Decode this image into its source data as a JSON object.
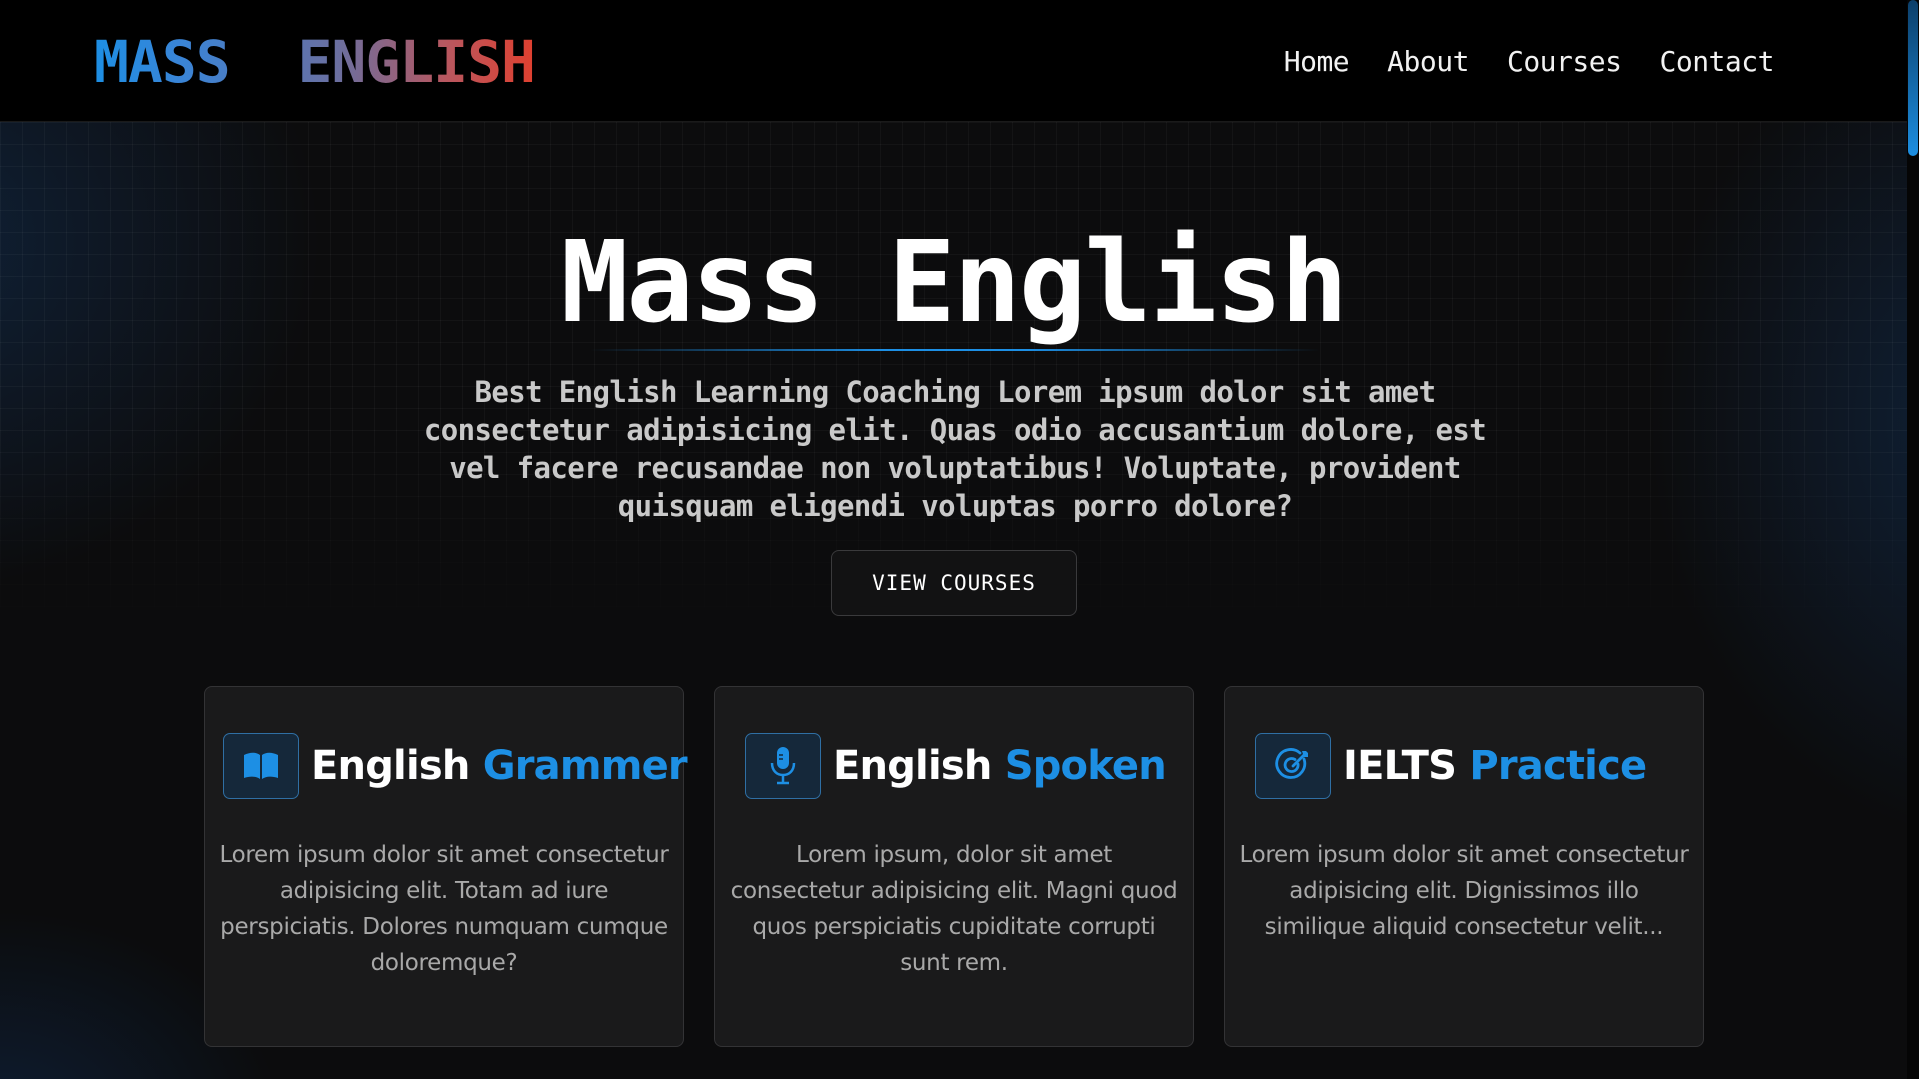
{
  "header": {
    "logo": "MASS  ENGLISH",
    "nav": [
      "Home",
      "About",
      "Courses",
      "Contact"
    ]
  },
  "hero": {
    "title": "Mass English",
    "subtitle": "Best English Learning Coaching Lorem ipsum dolor sit amet consectetur adipisicing elit. Quas odio accusantium dolore, est vel facere recusandae non voluptatibus! Voluptate, provident quisquam eligendi voluptas porro dolore?",
    "cta_label": "VIEW COURSES"
  },
  "cards": [
    {
      "icon": "book-icon",
      "title_part1": "English",
      "title_part2": "Grammer",
      "text": "Lorem ipsum dolor sit amet consectetur adipisicing elit. Totam ad iure perspiciatis. Dolores numquam cumque doloremque?"
    },
    {
      "icon": "microphone-icon",
      "title_part1": "English",
      "title_part2": "Spoken",
      "text": "Lorem ipsum, dolor sit amet consectetur adipisicing elit. Magni quod quos perspiciatis cupiditate corrupti sunt rem."
    },
    {
      "icon": "target-icon",
      "title_part1": "IELTS",
      "title_part2": "Practice",
      "text": "Lorem ipsum dolor sit amet consectetur adipisicing elit. Dignissimos illo similique aliquid consectetur velit..."
    }
  ],
  "colors": {
    "accent": "#1d8fe4",
    "logo_gradient_start": "#1d8fe4",
    "logo_gradient_end": "#e0402f",
    "background": "#0c0c0d",
    "card_background": "#1a1a1b"
  }
}
